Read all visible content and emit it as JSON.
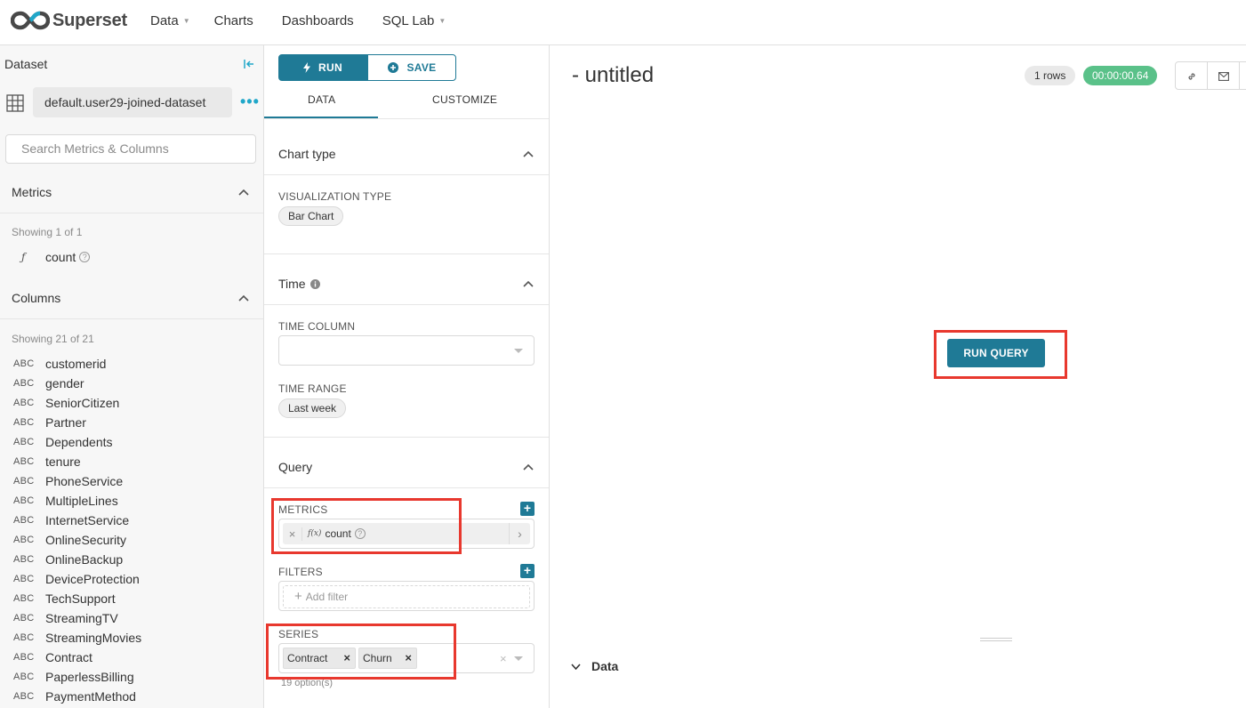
{
  "nav": {
    "brand": "Superset",
    "items": [
      {
        "label": "Data",
        "has_caret": true
      },
      {
        "label": "Charts",
        "has_caret": false
      },
      {
        "label": "Dashboards",
        "has_caret": false
      },
      {
        "label": "SQL Lab",
        "has_caret": true
      }
    ]
  },
  "dataset_panel": {
    "title": "Dataset",
    "dataset_name": "default.user29-joined-dataset",
    "search_placeholder": "Search Metrics & Columns",
    "metrics_title": "Metrics",
    "metrics_showing": "Showing 1 of 1",
    "metrics": [
      {
        "type_icon": "ƒ",
        "name": "count"
      }
    ],
    "columns_title": "Columns",
    "columns_showing": "Showing 21 of 21",
    "columns": [
      {
        "type": "ABC",
        "name": "customerid"
      },
      {
        "type": "ABC",
        "name": "gender"
      },
      {
        "type": "ABC",
        "name": "SeniorCitizen"
      },
      {
        "type": "ABC",
        "name": "Partner"
      },
      {
        "type": "ABC",
        "name": "Dependents"
      },
      {
        "type": "ABC",
        "name": "tenure"
      },
      {
        "type": "ABC",
        "name": "PhoneService"
      },
      {
        "type": "ABC",
        "name": "MultipleLines"
      },
      {
        "type": "ABC",
        "name": "InternetService"
      },
      {
        "type": "ABC",
        "name": "OnlineSecurity"
      },
      {
        "type": "ABC",
        "name": "OnlineBackup"
      },
      {
        "type": "ABC",
        "name": "DeviceProtection"
      },
      {
        "type": "ABC",
        "name": "TechSupport"
      },
      {
        "type": "ABC",
        "name": "StreamingTV"
      },
      {
        "type": "ABC",
        "name": "StreamingMovies"
      },
      {
        "type": "ABC",
        "name": "Contract"
      },
      {
        "type": "ABC",
        "name": "PaperlessBilling"
      },
      {
        "type": "ABC",
        "name": "PaymentMethod"
      }
    ]
  },
  "controls": {
    "run_label": "RUN",
    "save_label": "SAVE",
    "tab_data": "DATA",
    "tab_customize": "CUSTOMIZE",
    "chart_type_title": "Chart type",
    "viz_type_label": "VISUALIZATION TYPE",
    "viz_type_value": "Bar Chart",
    "time_title": "Time",
    "time_column_label": "TIME COLUMN",
    "time_column_value": "",
    "time_range_label": "TIME RANGE",
    "time_range_value": "Last week",
    "query_title": "Query",
    "metrics_label": "METRICS",
    "metric_fx": "f(x)",
    "metric_value": "count",
    "filters_label": "FILTERS",
    "add_filter": "Add filter",
    "series_label": "SERIES",
    "series_values": [
      "Contract",
      "Churn"
    ],
    "series_options": "19 option(s)"
  },
  "chart": {
    "title": "- untitled",
    "rows_badge": "1 rows",
    "time_badge": "00:00:00.64",
    "run_query_label": "RUN QUERY",
    "data_section": "Data"
  },
  "colors": {
    "primary": "#1f7a96",
    "success": "#5ac189",
    "annotation_red": "#e8382e",
    "link_blue": "#20a7c9"
  }
}
